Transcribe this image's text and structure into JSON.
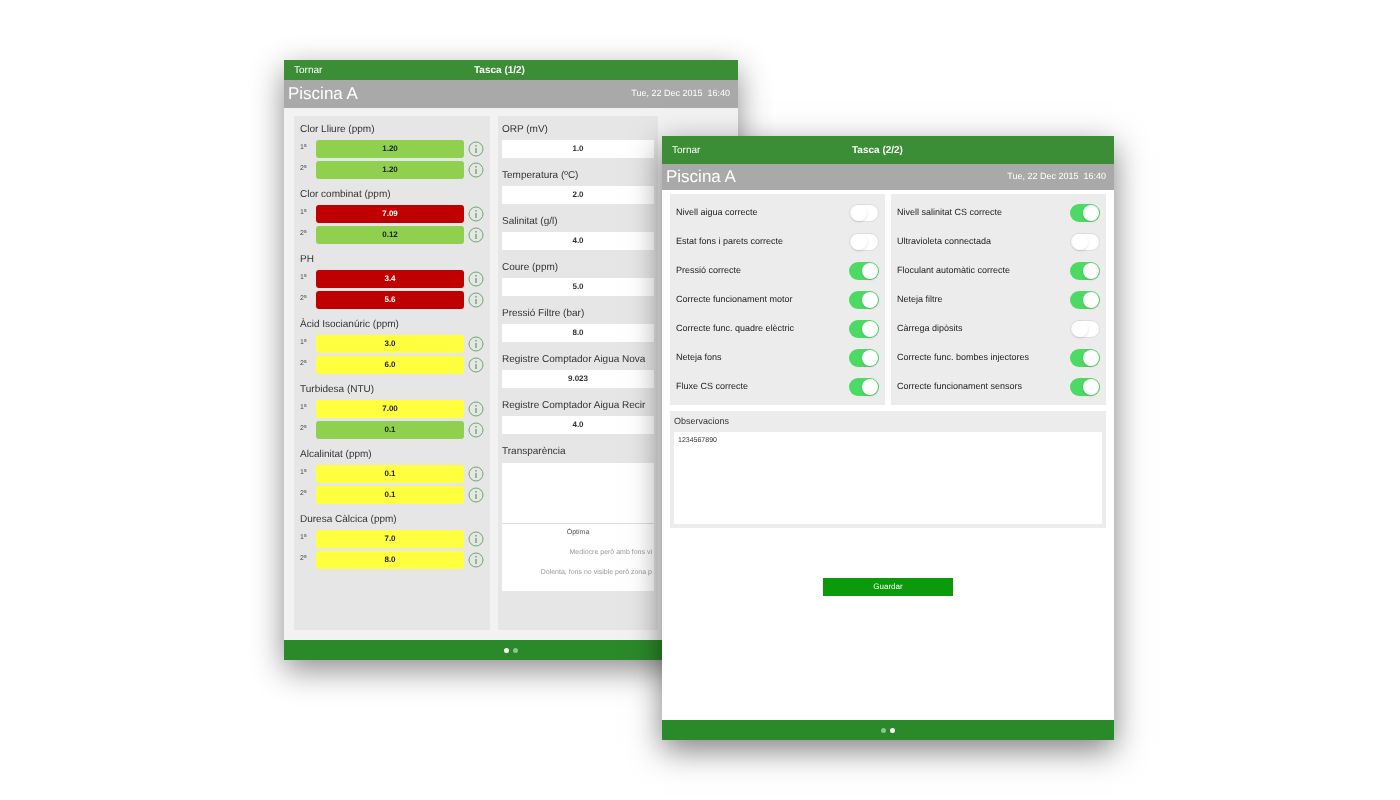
{
  "screens": [
    {
      "back": "Tornar",
      "title": "Tasca (1/2)",
      "pool": "Piscina A",
      "date": "Tue, 22 Dec 2015  16:40",
      "measures": [
        {
          "label": "Clor Lliure (ppm)",
          "readings": [
            {
              "ordinal": "1ª",
              "value": "1.20",
              "color": "#8fd14f"
            },
            {
              "ordinal": "2ª",
              "value": "1.20",
              "color": "#8fd14f"
            }
          ]
        },
        {
          "label": "Clor combinat (ppm)",
          "readings": [
            {
              "ordinal": "1ª",
              "value": "7.09",
              "color": "#c00000"
            },
            {
              "ordinal": "2ª",
              "value": "0.12",
              "color": "#8fd14f"
            }
          ]
        },
        {
          "label": "PH",
          "readings": [
            {
              "ordinal": "1ª",
              "value": "3.4",
              "color": "#c00000"
            },
            {
              "ordinal": "2ª",
              "value": "5.6",
              "color": "#c00000"
            }
          ]
        },
        {
          "label": "Àcid Isocianúric (ppm)",
          "readings": [
            {
              "ordinal": "1ª",
              "value": "3.0",
              "color": "#ffff40"
            },
            {
              "ordinal": "2ª",
              "value": "6.0",
              "color": "#ffff40"
            }
          ]
        },
        {
          "label": "Turbidesa (NTU)",
          "readings": [
            {
              "ordinal": "1ª",
              "value": "7.00",
              "color": "#ffff40"
            },
            {
              "ordinal": "2ª",
              "value": "0.1",
              "color": "#8fd14f"
            }
          ]
        },
        {
          "label": "Alcalinitat (ppm)",
          "readings": [
            {
              "ordinal": "1ª",
              "value": "0.1",
              "color": "#ffff40"
            },
            {
              "ordinal": "2ª",
              "value": "0.1",
              "color": "#ffff40"
            }
          ]
        },
        {
          "label": "Duresa Càlcica (ppm)",
          "readings": [
            {
              "ordinal": "1ª",
              "value": "7.0",
              "color": "#ffff40"
            },
            {
              "ordinal": "2ª",
              "value": "8.0",
              "color": "#ffff40"
            }
          ]
        }
      ],
      "fields": [
        {
          "label": "ORP (mV)",
          "value": "1.0"
        },
        {
          "label": "Temperatura (ºC)",
          "value": "2.0"
        },
        {
          "label": "Salinitat (g/l)",
          "value": "4.0"
        },
        {
          "label": "Coure (ppm)",
          "value": "5.0"
        },
        {
          "label": "Pressió Filtre (bar)",
          "value": "8.0"
        },
        {
          "label": "Registre Comptador Aigua Nova",
          "value": "9.023"
        },
        {
          "label": "Registre Comptador Aigua Recir",
          "value": "4.0"
        }
      ],
      "transparency": {
        "label": "Transparència",
        "options": [
          "Òptima",
          "Mediocre però amb fons vi",
          "Dolenta, fons no visible però zona p"
        ]
      },
      "page_dots": [
        {
          "selected": true
        },
        {
          "selected": false
        }
      ]
    },
    {
      "back": "Tornar",
      "title": "Tasca (2/2)",
      "pool": "Piscina A",
      "date": "Tue, 22 Dec 2015  16:40",
      "checks": [
        [
          {
            "label": "Nivell aigua correcte",
            "on": false
          },
          {
            "label": "Estat fons i parets correcte",
            "on": false
          },
          {
            "label": "Pressió correcte",
            "on": true
          },
          {
            "label": "Correcte funcionament motor",
            "on": true
          },
          {
            "label": "Correcte func. quadre elèctric",
            "on": true
          },
          {
            "label": "Neteja fons",
            "on": true
          },
          {
            "label": "Fluxe CS correcte",
            "on": true
          }
        ],
        [
          {
            "label": "Nivell salinitat CS correcte",
            "on": true
          },
          {
            "label": "Ultravioleta connectada",
            "on": false
          },
          {
            "label": "Floculant automàtic correcte",
            "on": true
          },
          {
            "label": "Neteja filtre",
            "on": true
          },
          {
            "label": "Càrrega dipòsits",
            "on": false
          },
          {
            "label": "Correcte func. bombes injectores",
            "on": true
          },
          {
            "label": "Correcte funcionament sensors",
            "on": true
          }
        ]
      ],
      "observations": {
        "label": "Observacions",
        "value": "1234567890"
      },
      "save_button": "Guardar",
      "page_dots": [
        {
          "selected": false
        },
        {
          "selected": true
        }
      ]
    }
  ]
}
